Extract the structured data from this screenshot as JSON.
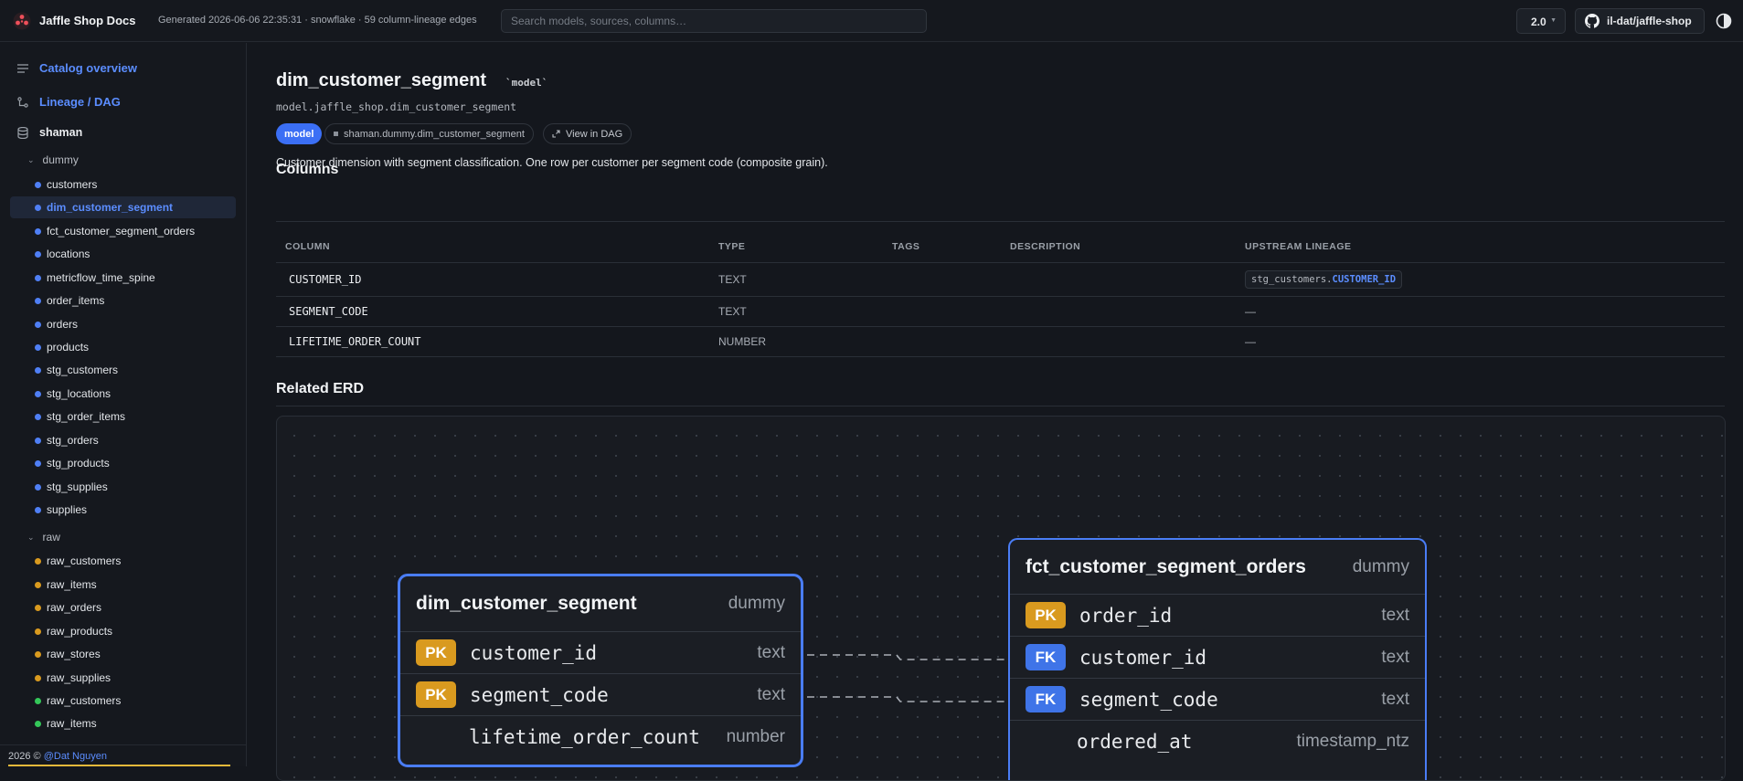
{
  "topbar": {
    "brand": "Jaffle Shop Docs",
    "meta": "Generated 2026-06-06 22:35:31 · snowflake · 59 column-lineage edges",
    "search_placeholder": "Search models, sources, columns…",
    "version": "2.0",
    "repo": "il-dat/jaffle-shop",
    "logo_icon": "jaffle-logo-icon",
    "theme_icon": "half-circle-icon"
  },
  "sidebar": {
    "catalog_overview": "Catalog overview",
    "lineage": "Lineage / DAG",
    "database": "shaman",
    "schemas": [
      {
        "name": "dummy",
        "items": [
          "customers",
          "dim_customer_segment",
          "fct_customer_segment_orders",
          "locations",
          "metricflow_time_spine",
          "order_items",
          "orders",
          "products",
          "stg_customers",
          "stg_locations",
          "stg_order_items",
          "stg_orders",
          "stg_products",
          "stg_supplies",
          "supplies"
        ]
      },
      {
        "name": "raw",
        "items": [
          "raw_customers",
          "raw_items",
          "raw_orders",
          "raw_products",
          "raw_stores",
          "raw_supplies",
          "raw_customers",
          "raw_items"
        ]
      }
    ],
    "active_item": "dim_customer_segment",
    "colors": {
      "model_dot": "#4f7ff5",
      "source_dot": "#d99a1f",
      "seed_dot": "#34c759"
    },
    "footer_text": "2026 © ",
    "footer_author": "@Dat Nguyen"
  },
  "page": {
    "title": "dim_customer_segment",
    "title_tag": "`model`",
    "unique_id": "model.jaffle_shop.dim_customer_segment",
    "resource_type": "model",
    "relation": "shaman.dummy.dim_customer_segment",
    "view_in_dag": "View in DAG",
    "description": "Customer dimension with segment classification. One row per customer per segment code (composite grain).",
    "columns_heading": "Columns",
    "erd_heading": "Related ERD"
  },
  "columns_table": {
    "headers": [
      "COLUMN",
      "TYPE",
      "TAGS",
      "DESCRIPTION",
      "UPSTREAM LINEAGE"
    ],
    "rows": [
      {
        "name": "CUSTOMER_ID",
        "type": "TEXT",
        "tags": "",
        "description": "",
        "lineage_model": "stg_customers.",
        "lineage_column": "CUSTOMER_ID"
      },
      {
        "name": "SEGMENT_CODE",
        "type": "TEXT",
        "tags": "",
        "description": "",
        "lineage_text": "—"
      },
      {
        "name": "LIFETIME_ORDER_COUNT",
        "type": "NUMBER",
        "tags": "",
        "description": "",
        "lineage_text": "—"
      }
    ]
  },
  "erd": {
    "nodes": [
      {
        "name": "dim_customer_segment",
        "schema": "dummy",
        "fields": [
          {
            "key": "PK",
            "name": "customer_id",
            "type": "text"
          },
          {
            "key": "PK",
            "name": "segment_code",
            "type": "text"
          },
          {
            "key": "",
            "name": "lifetime_order_count",
            "type": "number"
          }
        ]
      },
      {
        "name": "fct_customer_segment_orders",
        "schema": "dummy",
        "fields": [
          {
            "key": "PK",
            "name": "order_id",
            "type": "text"
          },
          {
            "key": "FK",
            "name": "customer_id",
            "type": "text"
          },
          {
            "key": "FK",
            "name": "segment_code",
            "type": "text"
          },
          {
            "key": "",
            "name": "ordered_at",
            "type": "timestamp_ntz"
          }
        ]
      }
    ],
    "colors": {
      "node_border": "#4a7df5",
      "pk": "#d99a1f",
      "fk": "#3f74e8"
    }
  }
}
